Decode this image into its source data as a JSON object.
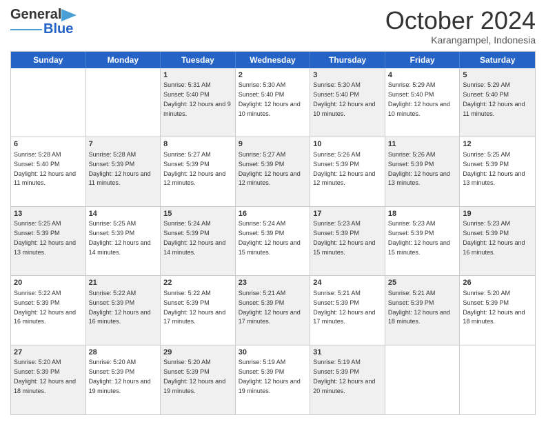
{
  "logo": {
    "line1": "General",
    "line2": "Blue"
  },
  "title": "October 2024",
  "location": "Karangampel, Indonesia",
  "header_days": [
    "Sunday",
    "Monday",
    "Tuesday",
    "Wednesday",
    "Thursday",
    "Friday",
    "Saturday"
  ],
  "weeks": [
    [
      {
        "day": "",
        "sunrise": "",
        "sunset": "",
        "daylight": "",
        "shaded": false
      },
      {
        "day": "",
        "sunrise": "",
        "sunset": "",
        "daylight": "",
        "shaded": false
      },
      {
        "day": "1",
        "sunrise": "Sunrise: 5:31 AM",
        "sunset": "Sunset: 5:40 PM",
        "daylight": "Daylight: 12 hours and 9 minutes.",
        "shaded": true
      },
      {
        "day": "2",
        "sunrise": "Sunrise: 5:30 AM",
        "sunset": "Sunset: 5:40 PM",
        "daylight": "Daylight: 12 hours and 10 minutes.",
        "shaded": false
      },
      {
        "day": "3",
        "sunrise": "Sunrise: 5:30 AM",
        "sunset": "Sunset: 5:40 PM",
        "daylight": "Daylight: 12 hours and 10 minutes.",
        "shaded": true
      },
      {
        "day": "4",
        "sunrise": "Sunrise: 5:29 AM",
        "sunset": "Sunset: 5:40 PM",
        "daylight": "Daylight: 12 hours and 10 minutes.",
        "shaded": false
      },
      {
        "day": "5",
        "sunrise": "Sunrise: 5:29 AM",
        "sunset": "Sunset: 5:40 PM",
        "daylight": "Daylight: 12 hours and 11 minutes.",
        "shaded": true
      }
    ],
    [
      {
        "day": "6",
        "sunrise": "Sunrise: 5:28 AM",
        "sunset": "Sunset: 5:40 PM",
        "daylight": "Daylight: 12 hours and 11 minutes.",
        "shaded": false
      },
      {
        "day": "7",
        "sunrise": "Sunrise: 5:28 AM",
        "sunset": "Sunset: 5:39 PM",
        "daylight": "Daylight: 12 hours and 11 minutes.",
        "shaded": true
      },
      {
        "day": "8",
        "sunrise": "Sunrise: 5:27 AM",
        "sunset": "Sunset: 5:39 PM",
        "daylight": "Daylight: 12 hours and 12 minutes.",
        "shaded": false
      },
      {
        "day": "9",
        "sunrise": "Sunrise: 5:27 AM",
        "sunset": "Sunset: 5:39 PM",
        "daylight": "Daylight: 12 hours and 12 minutes.",
        "shaded": true
      },
      {
        "day": "10",
        "sunrise": "Sunrise: 5:26 AM",
        "sunset": "Sunset: 5:39 PM",
        "daylight": "Daylight: 12 hours and 12 minutes.",
        "shaded": false
      },
      {
        "day": "11",
        "sunrise": "Sunrise: 5:26 AM",
        "sunset": "Sunset: 5:39 PM",
        "daylight": "Daylight: 12 hours and 13 minutes.",
        "shaded": true
      },
      {
        "day": "12",
        "sunrise": "Sunrise: 5:25 AM",
        "sunset": "Sunset: 5:39 PM",
        "daylight": "Daylight: 12 hours and 13 minutes.",
        "shaded": false
      }
    ],
    [
      {
        "day": "13",
        "sunrise": "Sunrise: 5:25 AM",
        "sunset": "Sunset: 5:39 PM",
        "daylight": "Daylight: 12 hours and 13 minutes.",
        "shaded": true
      },
      {
        "day": "14",
        "sunrise": "Sunrise: 5:25 AM",
        "sunset": "Sunset: 5:39 PM",
        "daylight": "Daylight: 12 hours and 14 minutes.",
        "shaded": false
      },
      {
        "day": "15",
        "sunrise": "Sunrise: 5:24 AM",
        "sunset": "Sunset: 5:39 PM",
        "daylight": "Daylight: 12 hours and 14 minutes.",
        "shaded": true
      },
      {
        "day": "16",
        "sunrise": "Sunrise: 5:24 AM",
        "sunset": "Sunset: 5:39 PM",
        "daylight": "Daylight: 12 hours and 15 minutes.",
        "shaded": false
      },
      {
        "day": "17",
        "sunrise": "Sunrise: 5:23 AM",
        "sunset": "Sunset: 5:39 PM",
        "daylight": "Daylight: 12 hours and 15 minutes.",
        "shaded": true
      },
      {
        "day": "18",
        "sunrise": "Sunrise: 5:23 AM",
        "sunset": "Sunset: 5:39 PM",
        "daylight": "Daylight: 12 hours and 15 minutes.",
        "shaded": false
      },
      {
        "day": "19",
        "sunrise": "Sunrise: 5:23 AM",
        "sunset": "Sunset: 5:39 PM",
        "daylight": "Daylight: 12 hours and 16 minutes.",
        "shaded": true
      }
    ],
    [
      {
        "day": "20",
        "sunrise": "Sunrise: 5:22 AM",
        "sunset": "Sunset: 5:39 PM",
        "daylight": "Daylight: 12 hours and 16 minutes.",
        "shaded": false
      },
      {
        "day": "21",
        "sunrise": "Sunrise: 5:22 AM",
        "sunset": "Sunset: 5:39 PM",
        "daylight": "Daylight: 12 hours and 16 minutes.",
        "shaded": true
      },
      {
        "day": "22",
        "sunrise": "Sunrise: 5:22 AM",
        "sunset": "Sunset: 5:39 PM",
        "daylight": "Daylight: 12 hours and 17 minutes.",
        "shaded": false
      },
      {
        "day": "23",
        "sunrise": "Sunrise: 5:21 AM",
        "sunset": "Sunset: 5:39 PM",
        "daylight": "Daylight: 12 hours and 17 minutes.",
        "shaded": true
      },
      {
        "day": "24",
        "sunrise": "Sunrise: 5:21 AM",
        "sunset": "Sunset: 5:39 PM",
        "daylight": "Daylight: 12 hours and 17 minutes.",
        "shaded": false
      },
      {
        "day": "25",
        "sunrise": "Sunrise: 5:21 AM",
        "sunset": "Sunset: 5:39 PM",
        "daylight": "Daylight: 12 hours and 18 minutes.",
        "shaded": true
      },
      {
        "day": "26",
        "sunrise": "Sunrise: 5:20 AM",
        "sunset": "Sunset: 5:39 PM",
        "daylight": "Daylight: 12 hours and 18 minutes.",
        "shaded": false
      }
    ],
    [
      {
        "day": "27",
        "sunrise": "Sunrise: 5:20 AM",
        "sunset": "Sunset: 5:39 PM",
        "daylight": "Daylight: 12 hours and 18 minutes.",
        "shaded": true
      },
      {
        "day": "28",
        "sunrise": "Sunrise: 5:20 AM",
        "sunset": "Sunset: 5:39 PM",
        "daylight": "Daylight: 12 hours and 19 minutes.",
        "shaded": false
      },
      {
        "day": "29",
        "sunrise": "Sunrise: 5:20 AM",
        "sunset": "Sunset: 5:39 PM",
        "daylight": "Daylight: 12 hours and 19 minutes.",
        "shaded": true
      },
      {
        "day": "30",
        "sunrise": "Sunrise: 5:19 AM",
        "sunset": "Sunset: 5:39 PM",
        "daylight": "Daylight: 12 hours and 19 minutes.",
        "shaded": false
      },
      {
        "day": "31",
        "sunrise": "Sunrise: 5:19 AM",
        "sunset": "Sunset: 5:39 PM",
        "daylight": "Daylight: 12 hours and 20 minutes.",
        "shaded": true
      },
      {
        "day": "",
        "sunrise": "",
        "sunset": "",
        "daylight": "",
        "shaded": false
      },
      {
        "day": "",
        "sunrise": "",
        "sunset": "",
        "daylight": "",
        "shaded": false
      }
    ]
  ]
}
